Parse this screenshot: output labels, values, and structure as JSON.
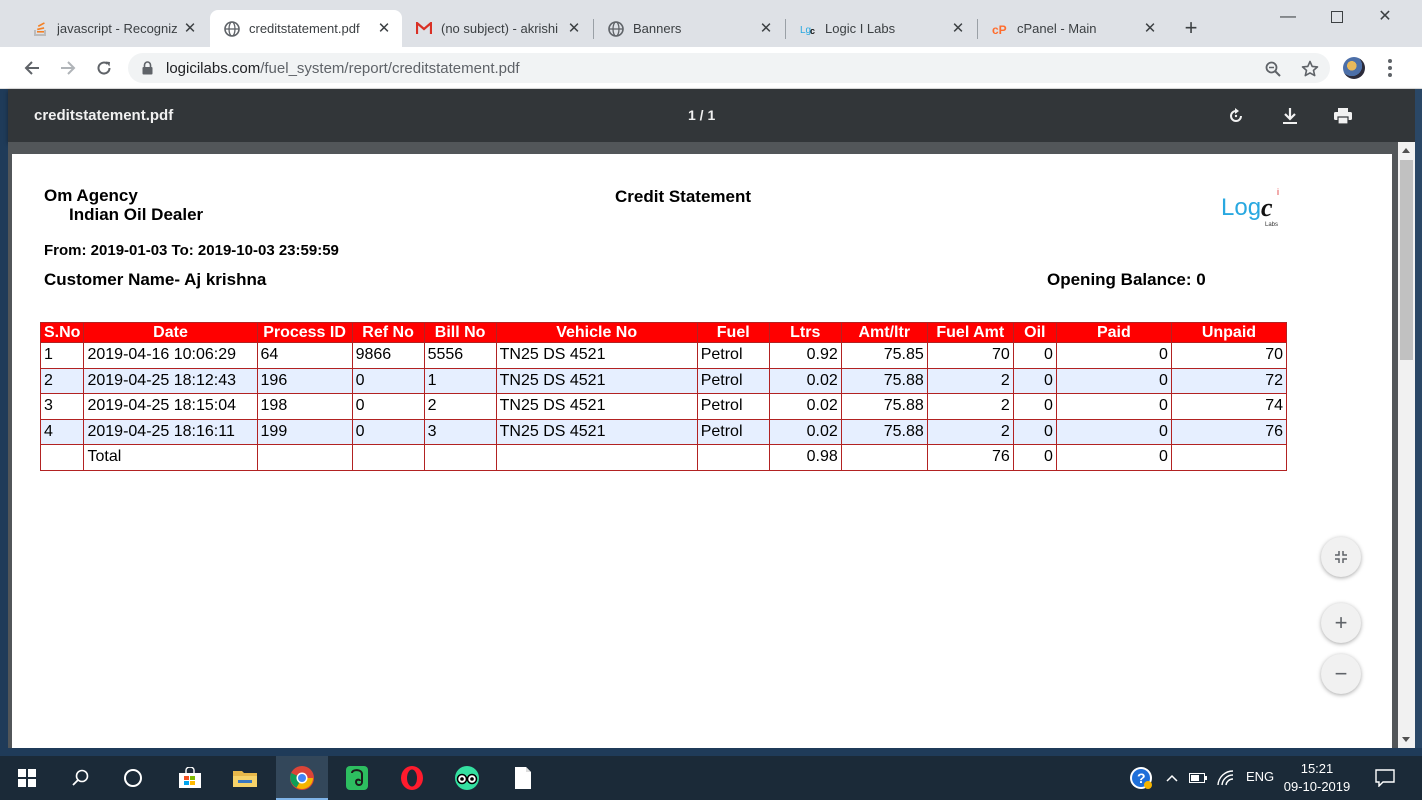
{
  "browser": {
    "tabs": [
      {
        "title": "javascript - Recogniz",
        "icon": "stackoverflow-icon"
      },
      {
        "title": "creditstatement.pdf",
        "icon": "globe-icon",
        "active": true
      },
      {
        "title": "(no subject) - akrishi",
        "icon": "gmail-icon"
      },
      {
        "title": "Banners",
        "icon": "globe-icon"
      },
      {
        "title": "Logic I Labs",
        "icon": "logic-labs-icon"
      },
      {
        "title": "cPanel - Main",
        "icon": "cpanel-icon"
      }
    ],
    "url_host": "logicilabs.com",
    "url_path": "/fuel_system/report/creditstatement.pdf"
  },
  "pdf_viewer": {
    "filename": "creditstatement.pdf",
    "page_indicator": "1 / 1"
  },
  "document": {
    "company": "Om Agency",
    "dealer": "Indian Oil Dealer",
    "title": "Credit Statement",
    "date_range": "From: 2019-01-03 To: 2019-10-03 23:59:59",
    "customer": "Customer Name- Aj krishna",
    "opening_balance": "Opening Balance: 0",
    "logo_text": "Logic",
    "logo_sub": "Labs",
    "logo_mark": "i",
    "table": {
      "headers": [
        "S.No",
        "Date",
        "Process ID",
        "Ref No",
        "Bill No",
        "Vehicle No",
        "Fuel",
        "Ltrs",
        "Amt/ltr",
        "Fuel Amt",
        "Oil",
        "Paid",
        "Unpaid"
      ],
      "rows": [
        [
          "1",
          "2019-04-16 10:06:29",
          "64",
          "9866",
          "5556",
          "TN25 DS 4521",
          "Petrol",
          "0.92",
          "75.85",
          "70",
          "0",
          "0",
          "70"
        ],
        [
          "2",
          "2019-04-25 18:12:43",
          "196",
          "0",
          "1",
          "TN25 DS 4521",
          "Petrol",
          "0.02",
          "75.88",
          "2",
          "0",
          "0",
          "72"
        ],
        [
          "3",
          "2019-04-25 18:15:04",
          "198",
          "0",
          "2",
          "TN25 DS 4521",
          "Petrol",
          "0.02",
          "75.88",
          "2",
          "0",
          "0",
          "74"
        ],
        [
          "4",
          "2019-04-25 18:16:11",
          "199",
          "0",
          "3",
          "TN25 DS 4521",
          "Petrol",
          "0.02",
          "75.88",
          "2",
          "0",
          "0",
          "76"
        ]
      ],
      "total": [
        "",
        "Total",
        "",
        "",
        "",
        "",
        "",
        "0.98",
        "",
        "76",
        "0",
        "0",
        ""
      ]
    }
  },
  "taskbar": {
    "language": "ENG",
    "time": "15:21",
    "date": "09-10-2019"
  }
}
